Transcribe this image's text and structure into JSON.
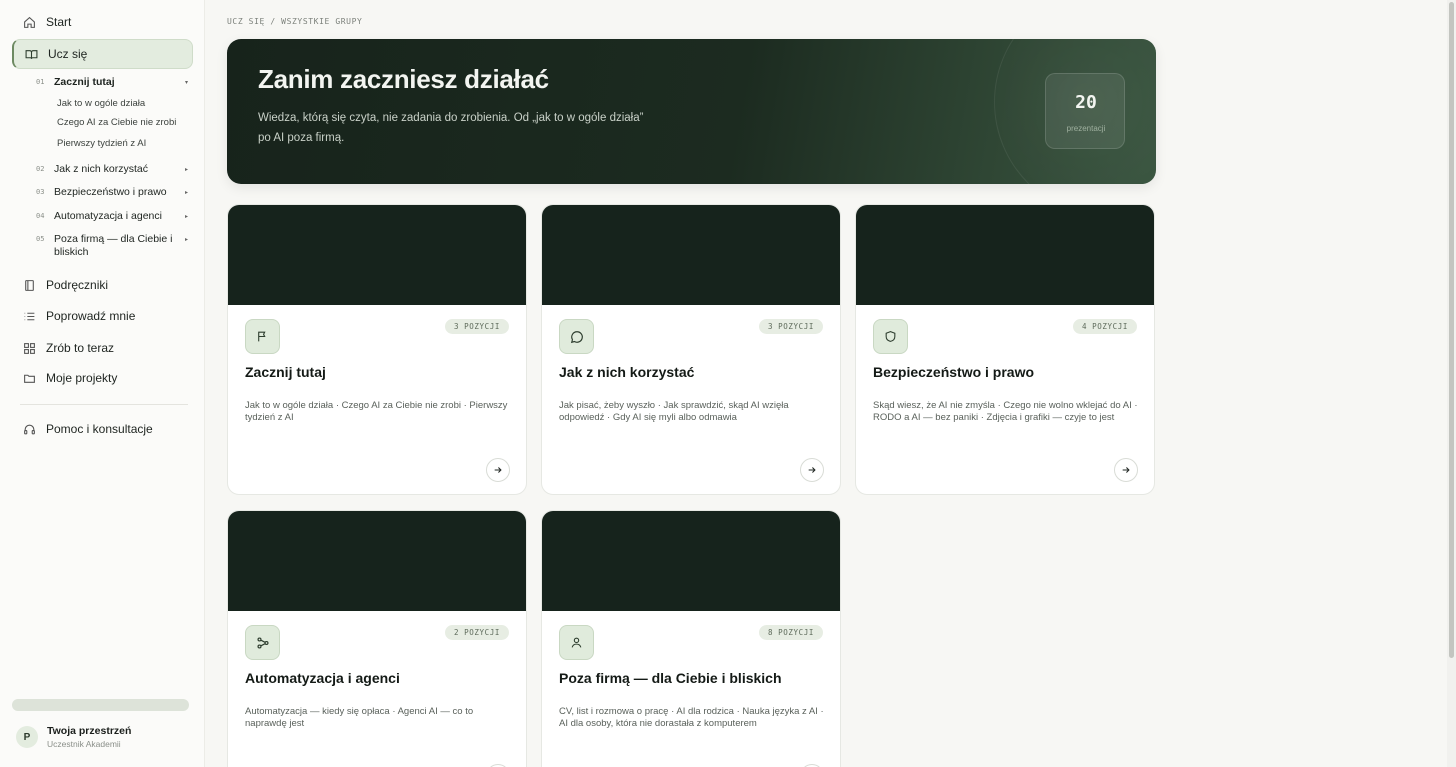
{
  "sidebar": {
    "nav": [
      {
        "label": "Start",
        "icon": "home-icon"
      },
      {
        "label": "Ucz się",
        "icon": "book-open-icon"
      },
      {
        "label": "Podręczniki",
        "icon": "book-icon"
      },
      {
        "label": "Poprowadź mnie",
        "icon": "list-icon"
      },
      {
        "label": "Zrób to teraz",
        "icon": "grid-icon"
      },
      {
        "label": "Moje projekty",
        "icon": "folder-icon"
      },
      {
        "label": "Pomoc i konsultacje",
        "icon": "headphones-icon"
      }
    ],
    "groups": [
      {
        "num": "01",
        "label": "Zacznij tutaj",
        "caret": "▾"
      },
      {
        "num": "02",
        "label": "Jak z nich korzystać",
        "caret": "▸"
      },
      {
        "num": "03",
        "label": "Bezpieczeństwo i prawo",
        "caret": "▸"
      },
      {
        "num": "04",
        "label": "Automatyzacja i agenci",
        "caret": "▸"
      },
      {
        "num": "05",
        "label": "Poza firmą — dla Ciebie i bliskich",
        "caret": "▸"
      }
    ],
    "leaves": [
      "Jak to w ogóle działa",
      "Czego AI za Ciebie nie zrobi",
      "Pierwszy tydzień z AI"
    ],
    "workspace": {
      "initial": "P",
      "name": "Twoja przestrzeń",
      "role": "Uczestnik Akademii"
    }
  },
  "breadcrumb": "UCZ SIĘ / WSZYSTKIE GRUPY",
  "hero": {
    "title": "Zanim zaczniesz działać",
    "description": "Wiedza, którą się czyta, nie zadania do zrobienia. Od „jak to w ogóle działa” po AI poza firmą.",
    "stat_value": "20",
    "stat_label": "prezentacji"
  },
  "cards": [
    {
      "title": "Zacznij tutaj",
      "badge": "3 POZYCJI",
      "icon": "flag-icon",
      "description": "Jak to w ogóle działa · Czego AI za Ciebie nie zrobi · Pierwszy tydzień z AI"
    },
    {
      "title": "Jak z nich korzystać",
      "badge": "3 POZYCJI",
      "icon": "chat-icon",
      "description": "Jak pisać, żeby wyszło · Jak sprawdzić, skąd AI wzięła odpowiedź · Gdy AI się myli albo odmawia"
    },
    {
      "title": "Bezpieczeństwo i prawo",
      "badge": "4 POZYCJI",
      "icon": "shield-icon",
      "description": "Skąd wiesz, że AI nie zmyśla · Czego nie wolno wklejać do AI · RODO a AI — bez paniki · Zdjęcia i grafiki — czyje to jest"
    },
    {
      "title": "Automatyzacja i agenci",
      "badge": "2 POZYCJI",
      "icon": "workflow-icon",
      "description": "Automatyzacja — kiedy się opłaca · Agenci AI — co to naprawdę jest"
    },
    {
      "title": "Poza firmą — dla Ciebie i bliskich",
      "badge": "8 POZYCJI",
      "icon": "user-icon",
      "description": "CV, list i rozmowa o pracę · AI dla rodzica · Nauka języka z AI · AI dla osoby, która nie dorastała z komputerem"
    }
  ],
  "colors": {
    "accent": "#6d8a62",
    "hero_dark": "#17231b",
    "cover": "#16231c",
    "icon_bg": "#e0ebdc"
  }
}
